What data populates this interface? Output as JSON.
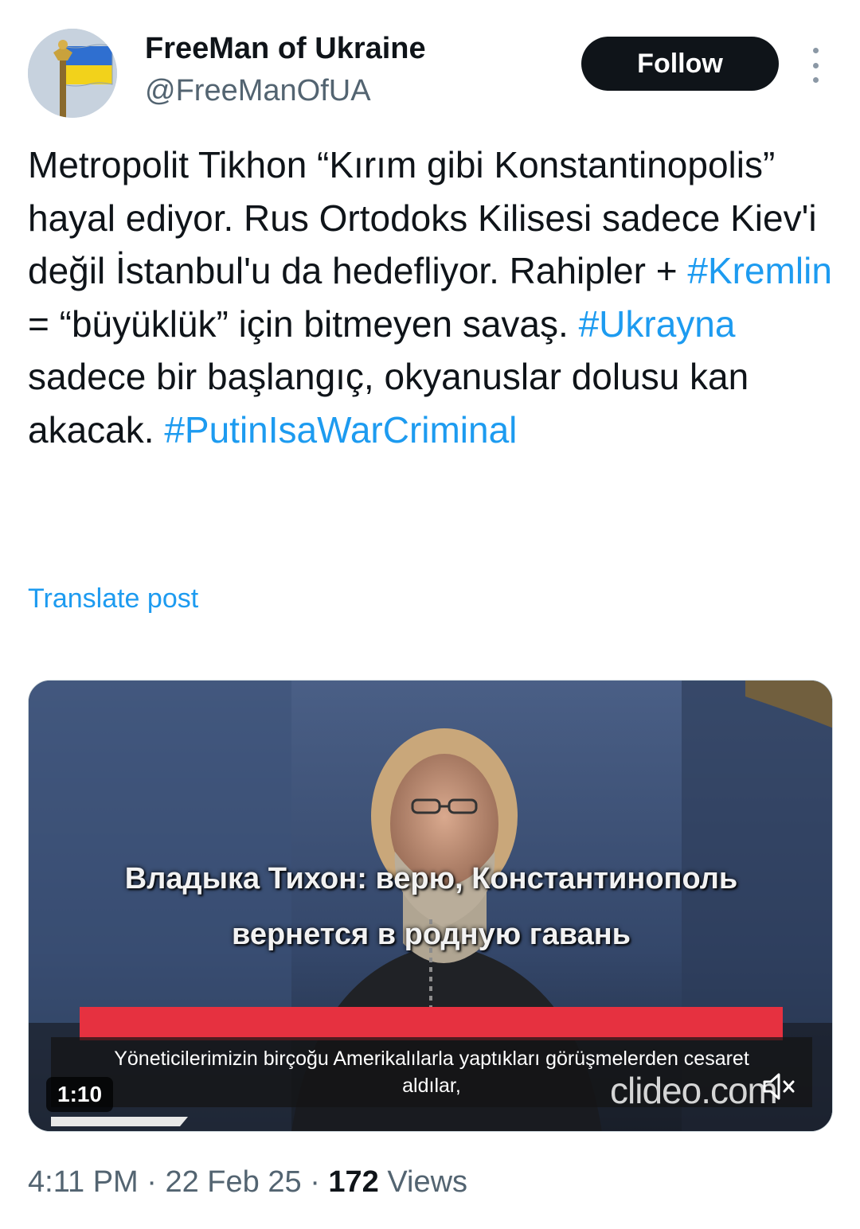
{
  "author": {
    "display_name": "FreeMan of Ukraine",
    "handle": "@FreeManOfUA",
    "avatar_icon": "ukraine-flag-monument-avatar"
  },
  "actions": {
    "follow_label": "Follow",
    "more_icon": "more-vertical-icon"
  },
  "tweet": {
    "segments": [
      {
        "type": "text",
        "text": "Metropolit Tikhon “Kırım gibi Konstantinopolis” hayal ediyor. Rus Ortodoks Kilisesi sadece Kiev'i değil İstanbul'u da hedefliyor. Rahipler + "
      },
      {
        "type": "hashtag",
        "text": "#Kremlin"
      },
      {
        "type": "text",
        "text": " = “büyüklük” için bitmeyen savaş. "
      },
      {
        "type": "hashtag",
        "text": "#Ukrayna"
      },
      {
        "type": "text",
        "text": " sadece bir başlangıç, okyanuslar dolusu kan akacak. "
      },
      {
        "type": "hashtag",
        "text": "#PutinIsaWarCriminal"
      }
    ],
    "translate_label": "Translate post"
  },
  "media": {
    "caption_line_1": "Владыка Тихон: верю, Константинополь",
    "caption_line_2": "вернется в родную гавань",
    "subtitle_line_1": "Yöneticilerimizin birçoğu Amerikalılarla yaptıkları görüşmelerden cesaret",
    "subtitle_line_2": "aldılar,",
    "watermark": "clideo.com",
    "duration": "1:10",
    "mute_icon": "muted-speaker-icon"
  },
  "meta": {
    "time": "4:11 PM",
    "separator": "·",
    "date": "22 Feb 25",
    "views_count": "172",
    "views_label": "Views"
  },
  "colors": {
    "link": "#1d9bf0",
    "text": "#0f1419",
    "secondary": "#536471",
    "follow_bg": "#0f1419",
    "caption_red": "#e63140"
  }
}
